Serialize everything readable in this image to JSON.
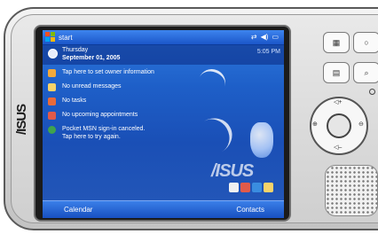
{
  "device": {
    "brand_logo": "/ISUS"
  },
  "taskbar": {
    "start_label": "start",
    "status_icons": [
      "connectivity-icon",
      "volume-icon",
      "battery-icon"
    ]
  },
  "today": {
    "day": "Thursday",
    "date": "September 01, 2005",
    "time_snippet": "5:05 PM"
  },
  "items": [
    {
      "label": "Tap here to set owner information",
      "icon": "owner-icon",
      "color": "#f2a93b"
    },
    {
      "label": "No unread messages",
      "icon": "mail-icon",
      "color": "#f7d36a"
    },
    {
      "label": "No tasks",
      "icon": "tasks-icon",
      "color": "#e86a3a"
    },
    {
      "label": "No upcoming appointments",
      "icon": "calendar-icon",
      "color": "#e05a4a"
    }
  ],
  "msn": {
    "line1": "Pocket MSN sign-in canceled.",
    "line2": "Tap here to try again."
  },
  "softkeys": {
    "left": "Calendar",
    "right": "Contacts"
  },
  "hardware": {
    "button_tl": "contacts-key-icon",
    "button_tr": "power-ring-icon",
    "button_bl": "calendar-key-icon",
    "button_br": "voice-record-icon",
    "dpad_up": "◁+",
    "dpad_down": "◁–",
    "dpad_left": "⊕",
    "dpad_right": "⊖"
  }
}
